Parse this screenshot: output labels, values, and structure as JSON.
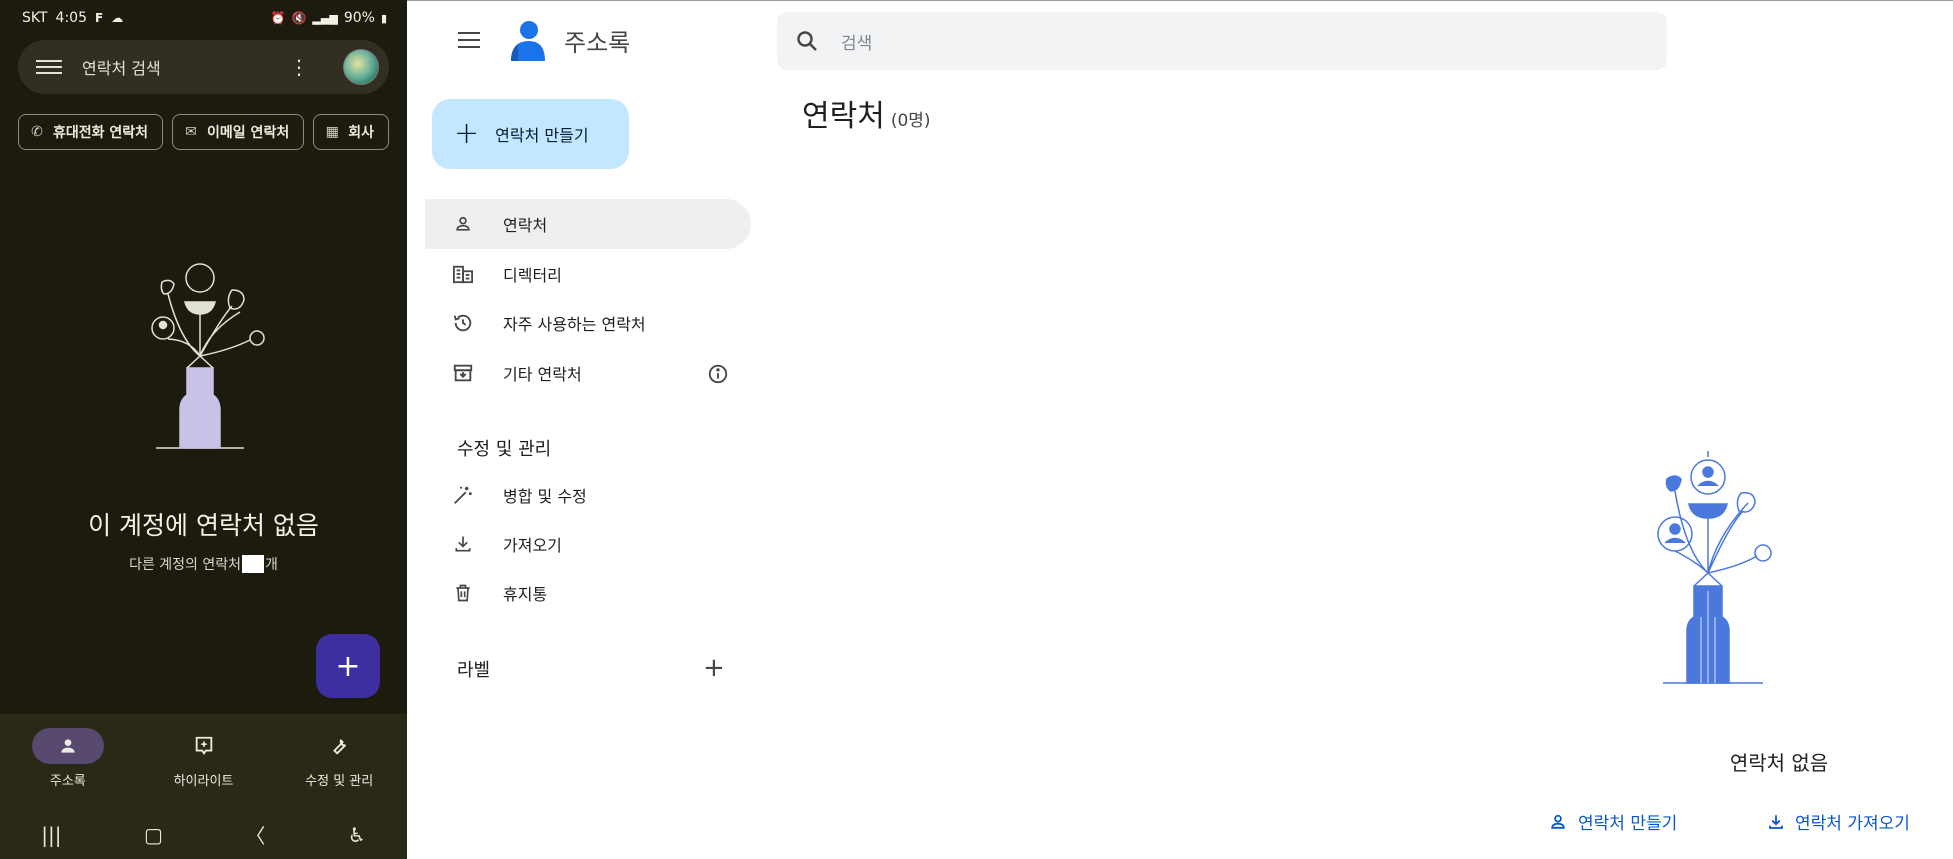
{
  "phone": {
    "status": {
      "carrier": "SKT",
      "time": "4:05",
      "battery": "90%"
    },
    "search_hint": "연락처 검색",
    "chips": [
      {
        "label": "휴대전화 연락처",
        "icon": "phone-icon"
      },
      {
        "label": "이메일 연락처",
        "icon": "mail-icon"
      },
      {
        "label": "회사",
        "icon": "building-icon"
      }
    ],
    "empty_title": "이 계정에 연락처 없음",
    "empty_sub_before": "다른 계정의 연락처",
    "empty_sub_after": "개",
    "nav": [
      {
        "label": "주소록",
        "icon": "person-icon",
        "active": true
      },
      {
        "label": "하이라이트",
        "icon": "highlight-icon",
        "active": false
      },
      {
        "label": "수정 및 관리",
        "icon": "wrench-icon",
        "active": false
      }
    ]
  },
  "web": {
    "app_title": "주소록",
    "search_placeholder": "검색",
    "create_label": "연락처 만들기",
    "sidebar": [
      {
        "label": "연락처",
        "icon": "person-icon",
        "active": true
      },
      {
        "label": "디렉터리",
        "icon": "building-icon",
        "active": false
      },
      {
        "label": "자주 사용하는 연락처",
        "icon": "history-icon",
        "active": false
      },
      {
        "label": "기타 연락처",
        "icon": "archive-icon",
        "active": false
      }
    ],
    "manage_heading": "수정 및 관리",
    "manage_items": [
      {
        "label": "병합 및 수정",
        "icon": "magic-wand-icon"
      },
      {
        "label": "가져오기",
        "icon": "download-icon"
      },
      {
        "label": "휴지통",
        "icon": "trash-icon"
      }
    ],
    "labels_heading": "라벨",
    "page_title": "연락처",
    "page_count": "(0명)",
    "empty_text": "연락처 없음",
    "action_create": "연락처 만들기",
    "action_import": "연락처 가져오기"
  },
  "colors": {
    "phone_bg": "#1c1b0d",
    "fab": "#3d2fa0",
    "web_accent": "#0b57d0",
    "create_button_bg": "#c2e7ff",
    "illustration_blue": "#4a78dc"
  }
}
